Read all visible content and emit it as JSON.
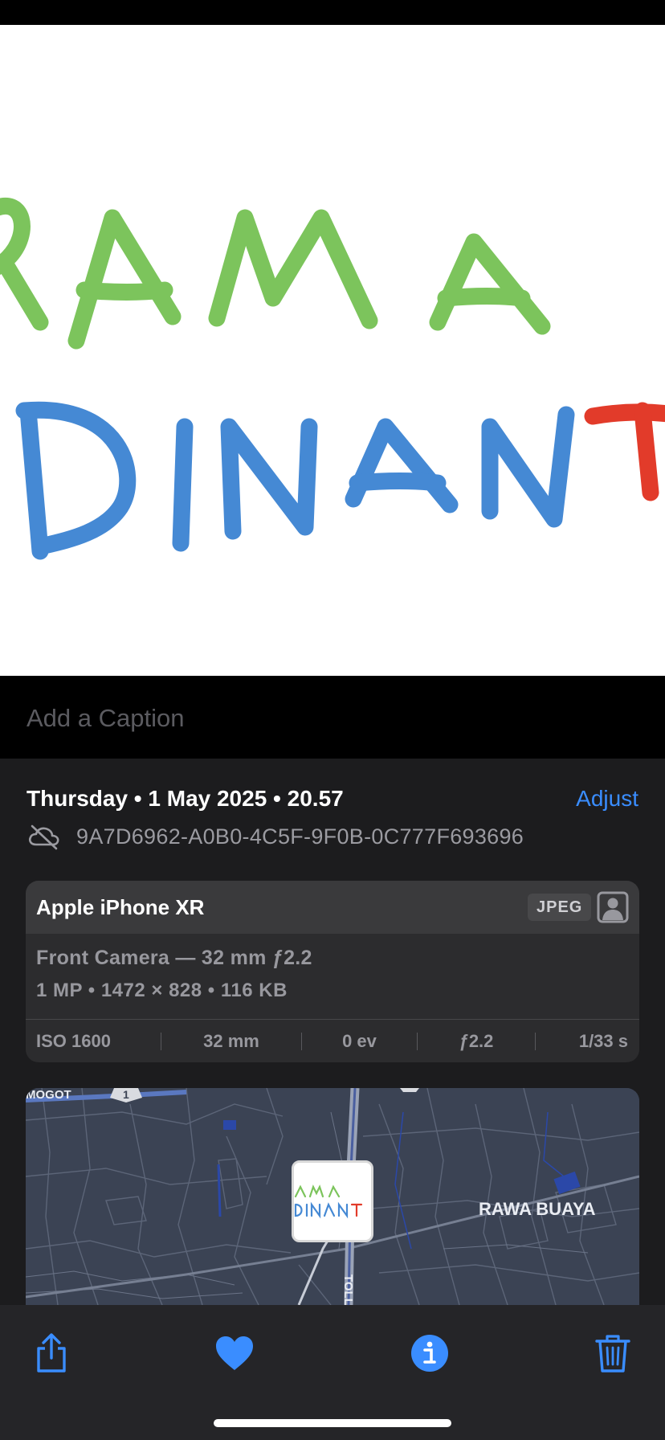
{
  "photo": {
    "line1": "RAMA",
    "line2_main": "DINAN",
    "line2_accent": "T",
    "colors": {
      "line1": "#7cc45c",
      "line2": "#4589d4",
      "accent": "#e23b2a"
    }
  },
  "caption": {
    "placeholder": "Add a Caption",
    "value": ""
  },
  "info": {
    "date": "Thursday • 1 May 2025 • 20.57",
    "adjust_label": "Adjust",
    "cloud_icon": "icloud-slash-icon",
    "uuid": "9A7D6962-A0B0-4C5F-9F0B-0C777F693696"
  },
  "camera": {
    "device": "Apple iPhone XR",
    "format": "JPEG",
    "lens": "Front Camera — 32 mm ƒ2.2",
    "specs": "1 MP  •  1472 × 828  •  116 KB",
    "exif": [
      {
        "id": "iso",
        "label": "ISO 1600"
      },
      {
        "id": "focal",
        "label": "32 mm"
      },
      {
        "id": "ev",
        "label": "0 ev"
      },
      {
        "id": "aperture",
        "label": "ƒ2.2"
      },
      {
        "id": "shutter",
        "label": "1/33 s"
      }
    ]
  },
  "map": {
    "labels": {
      "top_left": "MOGOT",
      "area": "RAWA BUAYA",
      "road": "TOLLI",
      "route_number": "1"
    }
  },
  "toolbar": {
    "share_icon": "share-icon",
    "favorite_icon": "heart-icon",
    "info_icon": "info-icon",
    "delete_icon": "trash-icon",
    "accent": "#3a8dff"
  }
}
